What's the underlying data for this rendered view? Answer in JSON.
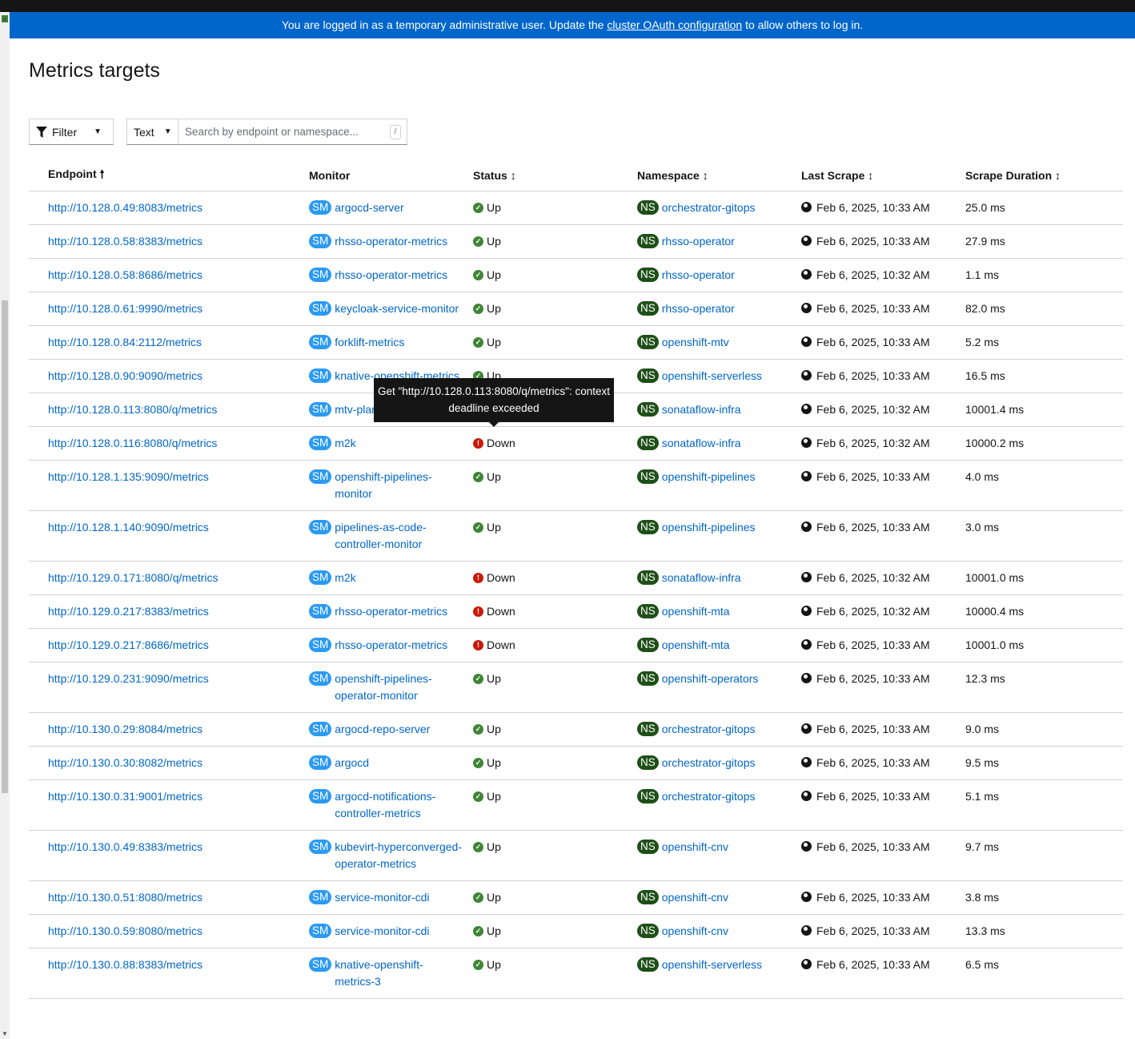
{
  "banner": {
    "prefix": "You are logged in as a temporary administrative user. Update the ",
    "link": "cluster OAuth configuration",
    "suffix": " to allow others to log in.",
    "color": "#0066cc"
  },
  "page_title": "Metrics targets",
  "toolbar": {
    "filter_label": "Filter",
    "type_label": "Text",
    "search_placeholder": "Search by endpoint or namespace...",
    "shortcut": "/"
  },
  "columns": [
    "Endpoint",
    "Monitor",
    "Status",
    "Namespace",
    "Last Scrape",
    "Scrape Duration"
  ],
  "monitor_badge": "SM",
  "namespace_badge": "NS",
  "tooltip": "Get \"http://10.128.0.113:8080/q/metrics\": context deadline exceeded",
  "rows": [
    {
      "endpoint": "http://10.128.0.49:8083/metrics",
      "monitor": "argocd-server",
      "status": "Up",
      "namespace": "orchestrator-gitops",
      "last_scrape": "Feb 6, 2025, 10:33 AM",
      "duration": "25.0 ms"
    },
    {
      "endpoint": "http://10.128.0.58:8383/metrics",
      "monitor": "rhsso-operator-metrics",
      "status": "Up",
      "namespace": "rhsso-operator",
      "last_scrape": "Feb 6, 2025, 10:33 AM",
      "duration": "27.9 ms"
    },
    {
      "endpoint": "http://10.128.0.58:8686/metrics",
      "monitor": "rhsso-operator-metrics",
      "status": "Up",
      "namespace": "rhsso-operator",
      "last_scrape": "Feb 6, 2025, 10:32 AM",
      "duration": "1.1 ms"
    },
    {
      "endpoint": "http://10.128.0.61:9990/metrics",
      "monitor": "keycloak-service-monitor",
      "status": "Up",
      "namespace": "rhsso-operator",
      "last_scrape": "Feb 6, 2025, 10:33 AM",
      "duration": "82.0 ms"
    },
    {
      "endpoint": "http://10.128.0.84:2112/metrics",
      "monitor": "forklift-metrics",
      "status": "Up",
      "namespace": "openshift-mtv",
      "last_scrape": "Feb 6, 2025, 10:33 AM",
      "duration": "5.2 ms"
    },
    {
      "endpoint": "http://10.128.0.90:9090/metrics",
      "monitor": "knative-openshift-metrics",
      "status": "Up",
      "namespace": "openshift-serverless",
      "last_scrape": "Feb 6, 2025, 10:33 AM",
      "duration": "16.5 ms"
    },
    {
      "endpoint": "http://10.128.0.113:8080/q/metrics",
      "monitor": "mtv-plan",
      "status": "Down",
      "namespace": "sonataflow-infra",
      "last_scrape": "Feb 6, 2025, 10:32 AM",
      "duration": "10001.4 ms"
    },
    {
      "endpoint": "http://10.128.0.116:8080/q/metrics",
      "monitor": "m2k",
      "status": "Down",
      "namespace": "sonataflow-infra",
      "last_scrape": "Feb 6, 2025, 10:32 AM",
      "duration": "10000.2 ms"
    },
    {
      "endpoint": "http://10.128.1.135:9090/metrics",
      "monitor": "openshift-pipelines-monitor",
      "status": "Up",
      "namespace": "openshift-pipelines",
      "last_scrape": "Feb 6, 2025, 10:33 AM",
      "duration": "4.0 ms"
    },
    {
      "endpoint": "http://10.128.1.140:9090/metrics",
      "monitor": "pipelines-as-code-controller-monitor",
      "status": "Up",
      "namespace": "openshift-pipelines",
      "last_scrape": "Feb 6, 2025, 10:33 AM",
      "duration": "3.0 ms"
    },
    {
      "endpoint": "http://10.129.0.171:8080/q/metrics",
      "monitor": "m2k",
      "status": "Down",
      "namespace": "sonataflow-infra",
      "last_scrape": "Feb 6, 2025, 10:32 AM",
      "duration": "10001.0 ms"
    },
    {
      "endpoint": "http://10.129.0.217:8383/metrics",
      "monitor": "rhsso-operator-metrics",
      "status": "Down",
      "namespace": "openshift-mta",
      "last_scrape": "Feb 6, 2025, 10:32 AM",
      "duration": "10000.4 ms"
    },
    {
      "endpoint": "http://10.129.0.217:8686/metrics",
      "monitor": "rhsso-operator-metrics",
      "status": "Down",
      "namespace": "openshift-mta",
      "last_scrape": "Feb 6, 2025, 10:33 AM",
      "duration": "10001.0 ms"
    },
    {
      "endpoint": "http://10.129.0.231:9090/metrics",
      "monitor": "openshift-pipelines-operator-monitor",
      "status": "Up",
      "namespace": "openshift-operators",
      "last_scrape": "Feb 6, 2025, 10:33 AM",
      "duration": "12.3 ms"
    },
    {
      "endpoint": "http://10.130.0.29:8084/metrics",
      "monitor": "argocd-repo-server",
      "status": "Up",
      "namespace": "orchestrator-gitops",
      "last_scrape": "Feb 6, 2025, 10:33 AM",
      "duration": "9.0 ms"
    },
    {
      "endpoint": "http://10.130.0.30:8082/metrics",
      "monitor": "argocd",
      "status": "Up",
      "namespace": "orchestrator-gitops",
      "last_scrape": "Feb 6, 2025, 10:33 AM",
      "duration": "9.5 ms"
    },
    {
      "endpoint": "http://10.130.0.31:9001/metrics",
      "monitor": "argocd-notifications-controller-metrics",
      "status": "Up",
      "namespace": "orchestrator-gitops",
      "last_scrape": "Feb 6, 2025, 10:33 AM",
      "duration": "5.1 ms"
    },
    {
      "endpoint": "http://10.130.0.49:8383/metrics",
      "monitor": "kubevirt-hyperconverged-operator-metrics",
      "status": "Up",
      "namespace": "openshift-cnv",
      "last_scrape": "Feb 6, 2025, 10:33 AM",
      "duration": "9.7 ms"
    },
    {
      "endpoint": "http://10.130.0.51:8080/metrics",
      "monitor": "service-monitor-cdi",
      "status": "Up",
      "namespace": "openshift-cnv",
      "last_scrape": "Feb 6, 2025, 10:33 AM",
      "duration": "3.8 ms"
    },
    {
      "endpoint": "http://10.130.0.59:8080/metrics",
      "monitor": "service-monitor-cdi",
      "status": "Up",
      "namespace": "openshift-cnv",
      "last_scrape": "Feb 6, 2025, 10:33 AM",
      "duration": "13.3 ms"
    },
    {
      "endpoint": "http://10.130.0.88:8383/metrics",
      "monitor": "knative-openshift-metrics-3",
      "status": "Up",
      "namespace": "openshift-serverless",
      "last_scrape": "Feb 6, 2025, 10:33 AM",
      "duration": "6.5 ms"
    }
  ]
}
